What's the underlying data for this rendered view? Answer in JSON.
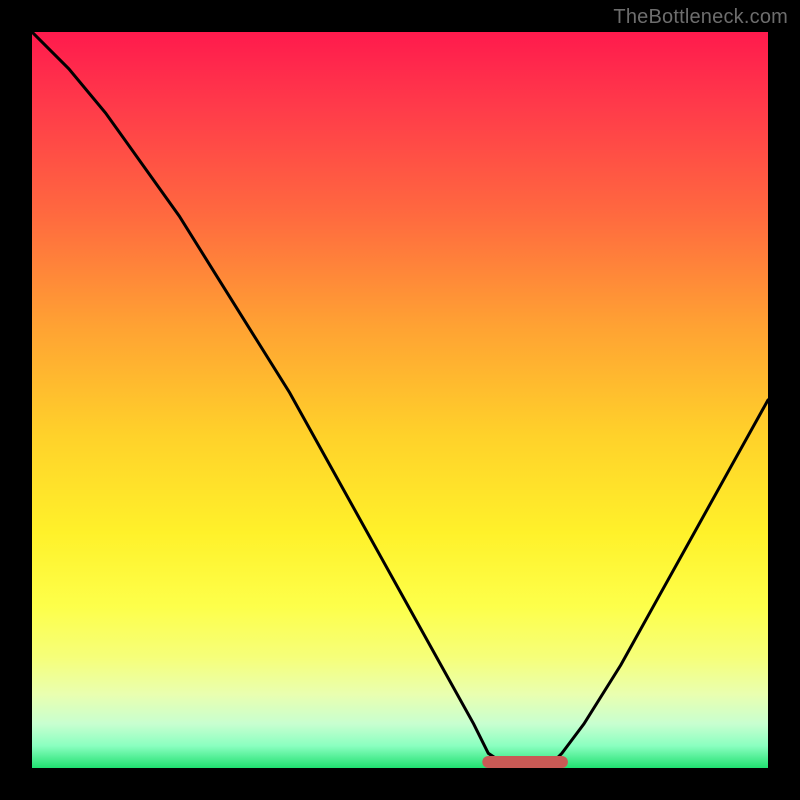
{
  "watermark": "TheBottleneck.com",
  "chart_data": {
    "type": "line",
    "title": "",
    "xlabel": "",
    "ylabel": "",
    "xlim": [
      0,
      100
    ],
    "ylim": [
      0,
      100
    ],
    "x": [
      0,
      5,
      10,
      15,
      20,
      25,
      30,
      35,
      40,
      45,
      50,
      55,
      60,
      62,
      65,
      68,
      70,
      72,
      75,
      80,
      85,
      90,
      95,
      100
    ],
    "y": [
      100,
      95,
      89,
      82,
      75,
      67,
      59,
      51,
      42,
      33,
      24,
      15,
      6,
      2,
      0,
      0,
      0,
      2,
      6,
      14,
      23,
      32,
      41,
      50
    ],
    "flat_region": {
      "x_start": 62,
      "x_end": 72,
      "y": 0
    },
    "flat_region_color": "#c85a55",
    "curve_color": "#000000",
    "background_gradient_stops": [
      {
        "pos": 0,
        "color": "#ff1a4d"
      },
      {
        "pos": 10,
        "color": "#ff3a4a"
      },
      {
        "pos": 25,
        "color": "#ff6a3f"
      },
      {
        "pos": 40,
        "color": "#ffa233"
      },
      {
        "pos": 55,
        "color": "#ffd22a"
      },
      {
        "pos": 68,
        "color": "#fff12a"
      },
      {
        "pos": 78,
        "color": "#fdff4a"
      },
      {
        "pos": 85,
        "color": "#f6ff7a"
      },
      {
        "pos": 90,
        "color": "#e9ffb0"
      },
      {
        "pos": 94,
        "color": "#c8ffd0"
      },
      {
        "pos": 97,
        "color": "#8affc0"
      },
      {
        "pos": 100,
        "color": "#20e070"
      }
    ]
  }
}
